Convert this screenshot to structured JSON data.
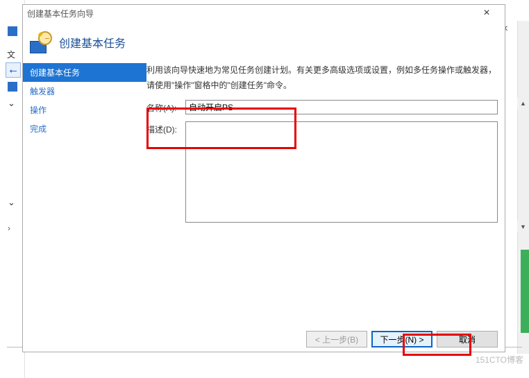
{
  "background": {
    "app_label": "文",
    "watermark": "151CTO博客"
  },
  "dialog": {
    "title": "创建基本任务向导",
    "heading": "创建基本任务",
    "helptext": "利用该向导快速地为常见任务创建计划。有关更多高级选项或设置，例如多任务操作或触发器，请使用\"操作\"窗格中的\"创建任务\"命令。",
    "steps": [
      {
        "label": "创建基本任务",
        "active": true
      },
      {
        "label": "触发器",
        "active": false
      },
      {
        "label": "操作",
        "active": false
      },
      {
        "label": "完成",
        "active": false
      }
    ],
    "form": {
      "name_label": "名称(A):",
      "name_value": "自动开启PS",
      "desc_label": "描述(D):",
      "desc_value": ""
    },
    "buttons": {
      "back": "< 上一步(B)",
      "next": "下一步(N) >",
      "cancel": "取消"
    }
  }
}
